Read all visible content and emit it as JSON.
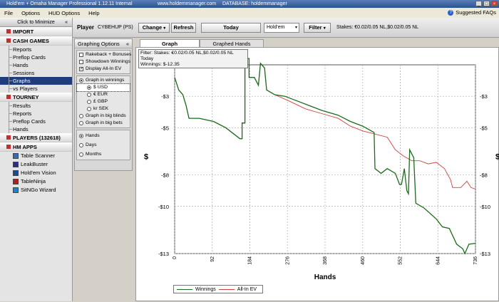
{
  "titlebar": {
    "app_title": "Hold'em + Omaha Manager Professional 1.12.11 Internal",
    "site": "www.holdemmanager.com",
    "database": "DATABASE: holdemmanager"
  },
  "menu": {
    "items": [
      "File",
      "Options",
      "HUD Options",
      "Help"
    ],
    "suggested_faqs": "Suggested FAQs"
  },
  "sidebar": {
    "minimize_label": "Click to Minimize",
    "import_label": "IMPORT",
    "cash_games_label": "CASH GAMES",
    "cash_items": [
      "Reports",
      "Preflop Cards",
      "Hands",
      "Sessions",
      "Graphs",
      "vs Players"
    ],
    "selected_item": "Graphs",
    "tourney_label": "TOURNEY",
    "tourney_items": [
      "Results",
      "Reports",
      "Preflop Cards",
      "Hands"
    ],
    "players_label": "PLAYERS (132618)",
    "hm_apps_label": "HM APPS",
    "apps": [
      "Table Scanner",
      "LeakBuster",
      "Hold'em Vision",
      "TableNinja",
      "SitNGo Wizard"
    ]
  },
  "toolbar": {
    "player_label": "Player",
    "player_name": "CYBEHUP (PS)",
    "change_label": "Change",
    "refresh_label": "Refresh",
    "today_label": "Today",
    "game_select": "Hold'em",
    "filter_label": "Filter",
    "stakes_text": "Stakes: €0.02/0.05 NL,$0.02/0.05 NL"
  },
  "graphing_options": {
    "title": "Graphing Options",
    "checkboxes": [
      {
        "label": "Rakeback + Bonuses",
        "checked": false
      },
      {
        "label": "Showdown Winnings",
        "checked": false
      },
      {
        "label": "Display All-In EV",
        "checked": true
      }
    ],
    "graph_in_winnings": "Graph in winnings",
    "currencies": [
      "$ USD",
      "€ EUR",
      "£ GBP",
      "kr SEK"
    ],
    "selected_currency": "$ USD",
    "graph_in_big_blinds": "Graph in big blinds",
    "graph_in_big_bets": "Graph in big bets",
    "x_axis_options": [
      "Hands",
      "Days",
      "Months"
    ],
    "selected_x_axis": "Hands"
  },
  "tabs": [
    {
      "label": "Graph",
      "active": true
    },
    {
      "label": "Graphed Hands",
      "active": false
    }
  ],
  "filter_box": {
    "line1": "Filter: Stakes: €0.02/0.05 NL,$0.02/0.05 NL",
    "line2": "Today",
    "line3": "Winnings: $-12.35"
  },
  "colors": {
    "winnings": "#1c6b1c",
    "allin_ev": "#d04040",
    "selection": "#203c7c"
  },
  "chart_data": {
    "type": "line",
    "xlabel": "Hands",
    "ylabel": "$",
    "xlim": [
      0,
      736
    ],
    "ylim": [
      -13,
      -1
    ],
    "x_ticks": [
      0,
      92,
      184,
      276,
      368,
      460,
      552,
      644,
      736
    ],
    "y_ticks": [
      -3,
      -5,
      -8,
      -10,
      -13
    ],
    "y_tick_labels": [
      "-$3",
      "-$5",
      "-$8",
      "-$10",
      "-$13"
    ],
    "legend": [
      "Winnings",
      "All-In EV"
    ],
    "legend_position": "bottom-left",
    "grid": true,
    "series": [
      {
        "name": "Winnings",
        "points": [
          [
            0,
            -1.8
          ],
          [
            10,
            -2.6
          ],
          [
            20,
            -2.9
          ],
          [
            28,
            -3.6
          ],
          [
            35,
            -4.4
          ],
          [
            60,
            -4.4
          ],
          [
            95,
            -4.6
          ],
          [
            125,
            -5.0
          ],
          [
            160,
            -5.7
          ],
          [
            165,
            -5.7
          ],
          [
            165,
            -4.7
          ],
          [
            172,
            -4.7
          ],
          [
            172,
            -0.6
          ],
          [
            182,
            -0.6
          ],
          [
            182,
            -1.8
          ],
          [
            195,
            -1.8
          ],
          [
            205,
            -2.3
          ],
          [
            210,
            -0.9
          ],
          [
            220,
            -1.2
          ],
          [
            225,
            -2.6
          ],
          [
            245,
            -2.9
          ],
          [
            270,
            -3.0
          ],
          [
            300,
            -3.3
          ],
          [
            330,
            -3.6
          ],
          [
            360,
            -3.9
          ],
          [
            400,
            -4.2
          ],
          [
            430,
            -4.6
          ],
          [
            460,
            -4.9
          ],
          [
            488,
            -5.3
          ],
          [
            490,
            -7.6
          ],
          [
            505,
            -7.9
          ],
          [
            520,
            -7.6
          ],
          [
            540,
            -7.9
          ],
          [
            550,
            -8.6
          ],
          [
            555,
            -8.6
          ],
          [
            562,
            -7.6
          ],
          [
            568,
            -9.0
          ],
          [
            572,
            -9.2
          ],
          [
            575,
            -6.4
          ],
          [
            585,
            -6.9
          ],
          [
            590,
            -9.8
          ],
          [
            610,
            -10.1
          ],
          [
            640,
            -10.8
          ],
          [
            655,
            -11.3
          ],
          [
            672,
            -11.4
          ],
          [
            690,
            -12.4
          ],
          [
            705,
            -12.7
          ],
          [
            710,
            -13.0
          ],
          [
            720,
            -12.4
          ],
          [
            736,
            -12.35
          ]
        ]
      },
      {
        "name": "All-In EV",
        "points": [
          [
            0,
            -1.8
          ],
          [
            10,
            -2.6
          ],
          [
            20,
            -2.9
          ],
          [
            28,
            -3.6
          ],
          [
            35,
            -4.4
          ],
          [
            60,
            -4.4
          ],
          [
            95,
            -4.6
          ],
          [
            125,
            -5.0
          ],
          [
            160,
            -5.7
          ],
          [
            165,
            -5.7
          ],
          [
            165,
            -4.7
          ],
          [
            172,
            -4.7
          ],
          [
            172,
            -0.6
          ],
          [
            182,
            -0.6
          ],
          [
            182,
            -1.8
          ],
          [
            195,
            -1.8
          ],
          [
            205,
            -2.3
          ],
          [
            210,
            -0.9
          ],
          [
            220,
            -1.2
          ],
          [
            225,
            -2.6
          ],
          [
            245,
            -2.9
          ],
          [
            280,
            -3.3
          ],
          [
            320,
            -3.8
          ],
          [
            360,
            -4.1
          ],
          [
            400,
            -4.4
          ],
          [
            430,
            -4.9
          ],
          [
            460,
            -5.2
          ],
          [
            490,
            -5.4
          ],
          [
            520,
            -5.6
          ],
          [
            540,
            -6.4
          ],
          [
            560,
            -6.8
          ],
          [
            580,
            -7.1
          ],
          [
            600,
            -7.1
          ],
          [
            620,
            -7.3
          ],
          [
            640,
            -7.2
          ],
          [
            660,
            -7.6
          ],
          [
            675,
            -8.3
          ],
          [
            680,
            -8.8
          ],
          [
            690,
            -8.8
          ],
          [
            700,
            -8.8
          ],
          [
            715,
            -8.4
          ],
          [
            725,
            -8.8
          ],
          [
            736,
            -8.9
          ]
        ]
      }
    ]
  }
}
